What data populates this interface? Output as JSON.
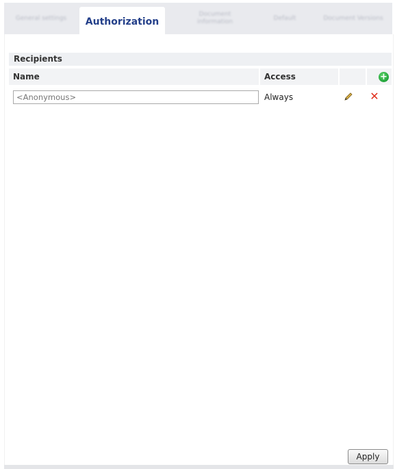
{
  "tabs": [
    {
      "label": "General settings",
      "active": false
    },
    {
      "label": "Authorization",
      "active": true
    },
    {
      "label": "Document information",
      "active": false
    },
    {
      "label": "Default",
      "active": false
    },
    {
      "label": "Document Versions",
      "active": false
    }
  ],
  "recipients": {
    "title": "Recipients",
    "columns": {
      "name": "Name",
      "access": "Access"
    },
    "add_icon": "plus-circle-icon",
    "rows": [
      {
        "name_placeholder": "<Anonymous>",
        "access": "Always",
        "edit_icon": "pencil-icon",
        "delete_icon": "x-icon"
      }
    ]
  },
  "buttons": {
    "apply": "Apply"
  },
  "colors": {
    "accent": "#24408a",
    "add": "#21a33a",
    "delete": "#e0301e"
  }
}
